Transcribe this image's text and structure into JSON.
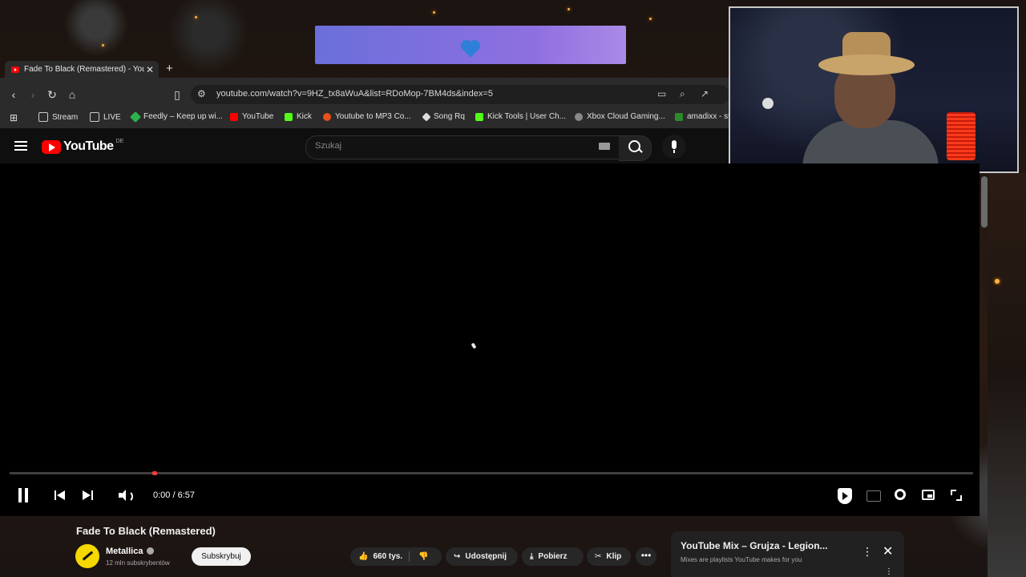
{
  "browser": {
    "tab_title": "Fade To Black (Remastered) - You",
    "tab_close": "✕",
    "new_tab": "+",
    "url": "youtube.com/watch?v=9HZ_tx8aWuA&list=RDoMop-7BM4ds&index=5"
  },
  "bookmarks": [
    {
      "label": "Stream",
      "icon": "folder-icon"
    },
    {
      "label": "LIVE",
      "icon": "folder-icon"
    },
    {
      "label": "Feedly – Keep up wi...",
      "icon": "feedly-icon"
    },
    {
      "label": "YouTube",
      "icon": "youtube-icon"
    },
    {
      "label": "Kick",
      "icon": "kick-icon"
    },
    {
      "label": "Youtube to MP3 Co...",
      "icon": "mp3-icon"
    },
    {
      "label": "Song Rq",
      "icon": "song-icon"
    },
    {
      "label": "Kick Tools | User Ch...",
      "icon": "kick-icon"
    },
    {
      "label": "Xbox Cloud Gaming...",
      "icon": "xbox-icon"
    },
    {
      "label": "amadixx - st",
      "icon": "twitch-icon"
    }
  ],
  "youtube": {
    "logo_text": "YouTube",
    "logo_region": "DE",
    "search_placeholder": "Szukaj"
  },
  "player": {
    "time": "0:00 / 6:57",
    "progress": 0
  },
  "video": {
    "title": "Fade To Black (Remastered)",
    "channel": "Metallica",
    "subscribers": "12 mln subskrybentów",
    "subscribe_label": "Subskrybuj",
    "likes": "660 tys.",
    "share_label": "Udostępnij",
    "download_label": "Pobierz",
    "clip_label": "Klip",
    "more_label": "•••"
  },
  "mix": {
    "title": "YouTube Mix – Grujza - Legion...",
    "subtitle": "Mixes are playlists YouTube makes for you",
    "kebab": "⋮",
    "close": "✕"
  },
  "colors": {
    "accent": "#ff0000",
    "background": "#0f0f0f",
    "alert_banner": "#7c70dc"
  }
}
